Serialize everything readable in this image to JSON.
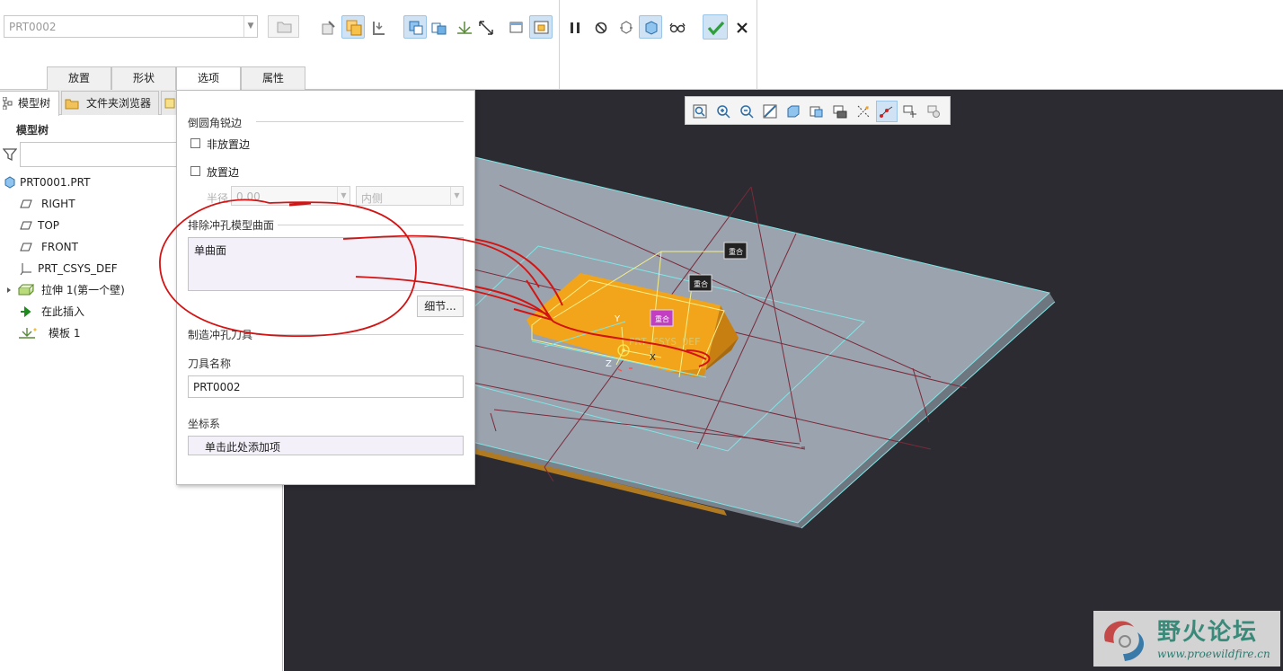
{
  "ribbon": {
    "name_combo_value": "PRT0002",
    "tabs": [
      "放置",
      "形状",
      "选项",
      "属性"
    ],
    "active_tab": "选项"
  },
  "left_panel": {
    "tabs": [
      "模型树",
      "文件夹浏览器"
    ],
    "tree_title": "模型树",
    "filter_placeholder": "",
    "tree_items": [
      {
        "label": "PRT0001.PRT",
        "icon": "part-icon"
      },
      {
        "label": "RIGHT",
        "icon": "datum-plane-icon"
      },
      {
        "label": "TOP",
        "icon": "datum-plane-icon"
      },
      {
        "label": "FRONT",
        "icon": "datum-plane-icon"
      },
      {
        "label": "PRT_CSYS_DEF",
        "icon": "csys-icon"
      },
      {
        "label": "拉伸 1(第一个壁)",
        "icon": "extrude-wall-icon"
      },
      {
        "label": "在此插入",
        "icon": "insert-here-arrow-icon"
      },
      {
        "label": "模板 1",
        "icon": "punch-form-icon"
      }
    ]
  },
  "options_panel": {
    "rounds_section": "倒圆角锐边",
    "non_placement_edges": "非放置边",
    "placement_edges": "放置边",
    "radius_label": "半径",
    "radius_value": "0.00",
    "side_value": "内侧",
    "exclude_section": "排除冲孔模型曲面",
    "surface_value": "单曲面",
    "details_button": "细节...",
    "punch_tool_section": "制造冲孔刀具",
    "tool_name_label": "刀具名称",
    "tool_name_value": "PRT0002",
    "csys_label": "坐标系",
    "csys_placeholder": "单击此处添加项"
  },
  "viewport": {
    "csys_label": "PRT_CSYS_DEF",
    "axis_labels": [
      "Y",
      "Z",
      "X"
    ],
    "tags": [
      "重合",
      "重合",
      "重合"
    ]
  },
  "watermark": {
    "name": "野火论坛",
    "url": "www.proewildfire.cn"
  },
  "colors": {
    "viewport_bg": "#2b2b31",
    "sheet_top": "#9aa3ae",
    "punch_body": "#f2a51a",
    "confirm_green": "#2f9e3b",
    "annotation_red": "#d21414"
  }
}
